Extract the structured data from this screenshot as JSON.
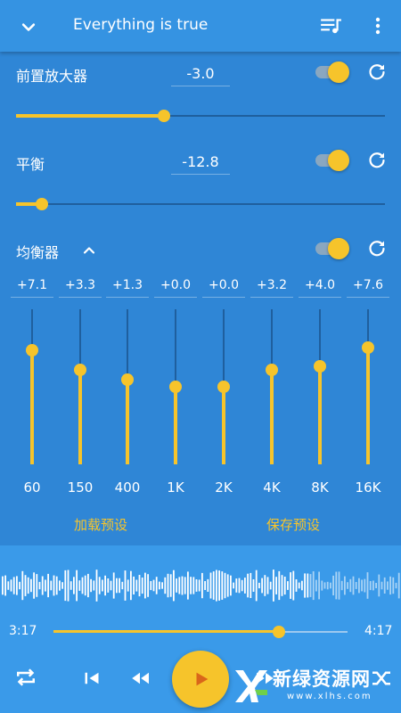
{
  "header": {
    "title": "Everything is true",
    "icons": [
      "chevron-down-icon",
      "queue-music-icon",
      "more-vert-icon"
    ]
  },
  "preamp": {
    "label": "前置放大器",
    "value": "-3.0",
    "enabled": true,
    "level_fraction": 0.4
  },
  "balance": {
    "label": "平衡",
    "value": "-12.8",
    "enabled": true,
    "level_fraction": 0.07
  },
  "equalizer": {
    "label": "均衡器",
    "enabled": true,
    "expanded": true,
    "bands": [
      {
        "freq": "60",
        "gain_label": "+7.1",
        "gain": 7.1
      },
      {
        "freq": "150",
        "gain_label": "+3.3",
        "gain": 3.3
      },
      {
        "freq": "400",
        "gain_label": "+1.3",
        "gain": 1.3
      },
      {
        "freq": "1K",
        "gain_label": "+0.0",
        "gain": 0.0
      },
      {
        "freq": "2K",
        "gain_label": "+0.0",
        "gain": 0.0
      },
      {
        "freq": "4K",
        "gain_label": "+3.2",
        "gain": 3.2
      },
      {
        "freq": "8K",
        "gain_label": "+4.0",
        "gain": 4.0
      },
      {
        "freq": "16K",
        "gain_label": "+7.6",
        "gain": 7.6
      }
    ],
    "load_preset": "加载预设",
    "save_preset": "保存预设"
  },
  "player": {
    "elapsed": "3:17",
    "duration": "4:17",
    "progress_fraction": 0.766
  },
  "watermark": {
    "title": "新绿资源网",
    "url": "www.xlhs.com"
  },
  "colors": {
    "accent": "#f6c42b",
    "background": "#2f86d6",
    "toolbar": "#3593e2",
    "player": "#3a9ae9"
  }
}
